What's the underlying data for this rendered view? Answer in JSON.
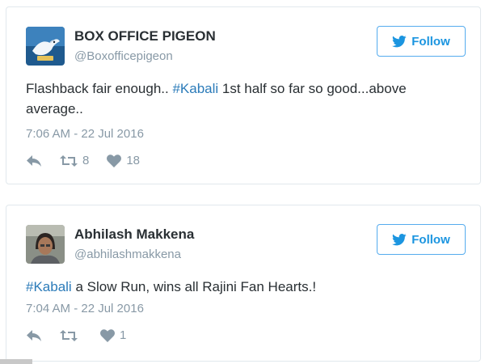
{
  "colors": {
    "accent": "#1b95e0",
    "hashtag": "#2b7bb9",
    "muted": "#8899a6",
    "text": "#292f33"
  },
  "tweets": [
    {
      "name": "BOX OFFICE PIGEON",
      "handle": "@Boxofficepigeon",
      "follow_label": "Follow",
      "text_pre": "Flashback fair enough.. ",
      "hashtag": "#Kabali",
      "text_post": " 1st half so far so good...above average..",
      "time": "7:06 AM - 22 Jul 2016",
      "retweets": "8",
      "likes": "18",
      "avatar_icon": "pigeon-logo",
      "icons": [
        "reply-icon",
        "retweet-icon",
        "heart-icon",
        "twitter-bird-icon"
      ]
    },
    {
      "name": "Abhilash Makkena",
      "handle": "@abhilashmakkena",
      "follow_label": "Follow",
      "text_pre": "",
      "hashtag": "#Kabali",
      "text_post": " a Slow Run, wins all Rajini Fan Hearts.!",
      "time": "7:04 AM - 22 Jul 2016",
      "retweets": "",
      "likes": "1",
      "avatar_icon": "user-photo",
      "icons": [
        "reply-icon",
        "retweet-icon",
        "heart-icon",
        "twitter-bird-icon"
      ]
    }
  ]
}
